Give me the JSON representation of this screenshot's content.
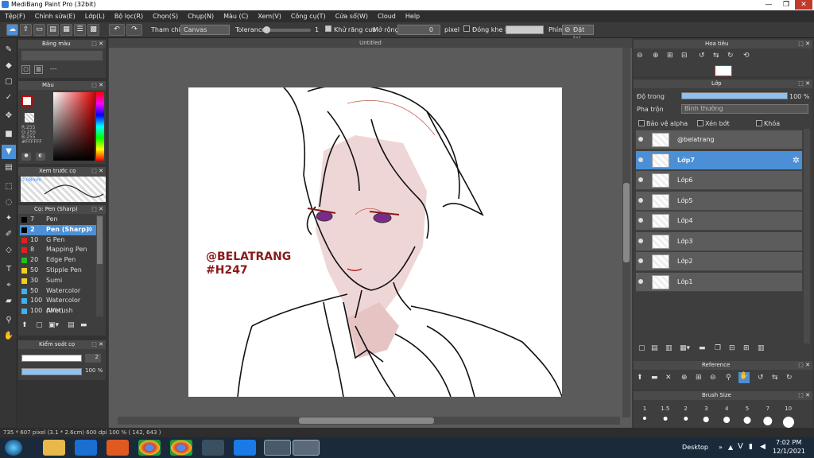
{
  "app": {
    "title": "MediBang Paint Pro (32bit)"
  },
  "menu": [
    "Tệp(F)",
    "Chỉnh sửa(E)",
    "Lớp(L)",
    "Bộ lọc(R)",
    "Chọn(S)",
    "Chụp(N)",
    "Màu (C)",
    "Xem(V)",
    "Công cụ(T)",
    "Cửa sổ(W)",
    "Cloud",
    "Help"
  ],
  "toolbar": {
    "reference_label": "Tham chiếu",
    "reference_value": "Canvas",
    "tolerance_label": "Tolerance",
    "tolerance_value": "1",
    "antialias_label": "Khử răng cưa",
    "expand_label": "Mở rộng",
    "expand_value": "0",
    "expand_unit": "pixel",
    "gap_close_label": "Đóng khe hở",
    "key_label": "Phím",
    "reset_label": "Đặt lại"
  },
  "panels": {
    "palette_title": "Bảng màu",
    "palette_more": "---",
    "color_title": "Màu",
    "color_values": [
      "R:255",
      "G:255",
      "B:255",
      "#FFFFFF"
    ],
    "brush_preview_title": "Xem trước cọ",
    "brush_preview_size": "0.08mm",
    "brush_title": "Cọ: Pen (Sharp)",
    "brush_control_title": "Kiểm soát cọ",
    "brush_size_value": "2",
    "brush_opacity_value": "100 %"
  },
  "brushes": [
    {
      "size": "7",
      "name": "Pen",
      "color": "#000000"
    },
    {
      "size": "2",
      "name": "Pen (Sharp)",
      "color": "#000000",
      "selected": true
    },
    {
      "size": "10",
      "name": "G Pen",
      "color": "#e02020"
    },
    {
      "size": "8",
      "name": "Mapping Pen",
      "color": "#e02020"
    },
    {
      "size": "20",
      "name": "Edge Pen",
      "color": "#20c020"
    },
    {
      "size": "50",
      "name": "Stipple Pen",
      "color": "#f0d020"
    },
    {
      "size": "30",
      "name": "Sumi",
      "color": "#f0d020"
    },
    {
      "size": "50",
      "name": "Watercolor",
      "color": "#40b0f0"
    },
    {
      "size": "100",
      "name": "Watercolor (Wet)",
      "color": "#40b0f0"
    },
    {
      "size": "100",
      "name": "Airbrush",
      "color": "#40b0f0"
    }
  ],
  "document": {
    "tab_title": "Untitled",
    "watermark_line1": "@BELATRANG",
    "watermark_line2": "#H247"
  },
  "navigator": {
    "title": "Hoa tiêu"
  },
  "layers_panel": {
    "title": "Lớp",
    "opacity_label": "Độ trong",
    "opacity_value": "100 %",
    "opacity": 1.0,
    "blend_label": "Pha trộn",
    "blend_value": "Bình thường",
    "protect_alpha_label": "Bảo vệ alpha",
    "clipping_label": "Xén bớt",
    "lock_label": "Khóa",
    "layers": [
      {
        "name": "@belatrang",
        "selected": false
      },
      {
        "name": "Lớp7",
        "selected": true
      },
      {
        "name": "Lớp6",
        "selected": false
      },
      {
        "name": "Lớp5",
        "selected": false
      },
      {
        "name": "Lớp4",
        "selected": false
      },
      {
        "name": "Lớp3",
        "selected": false
      },
      {
        "name": "Lớp2",
        "selected": false
      },
      {
        "name": "Lớp1",
        "selected": false
      }
    ]
  },
  "reference_panel": {
    "title": "Reference"
  },
  "brush_size_panel": {
    "title": "Brush Size",
    "sizes": [
      "1",
      "1.5",
      "2",
      "3",
      "4",
      "5",
      "7",
      "10"
    ]
  },
  "status": {
    "text": "735 * 607 pixel  (3.1 * 2.6cm)  600 dpi  100 %  ( 142, 643 )"
  },
  "taskbar": {
    "desktop_label": "Desktop",
    "lang": "V",
    "time": "7:02 PM",
    "date": "12/1/2021"
  },
  "colors": {
    "accent": "#4b8fd6",
    "skin": "#efd6d6",
    "watermark": "#8a1a1a"
  }
}
